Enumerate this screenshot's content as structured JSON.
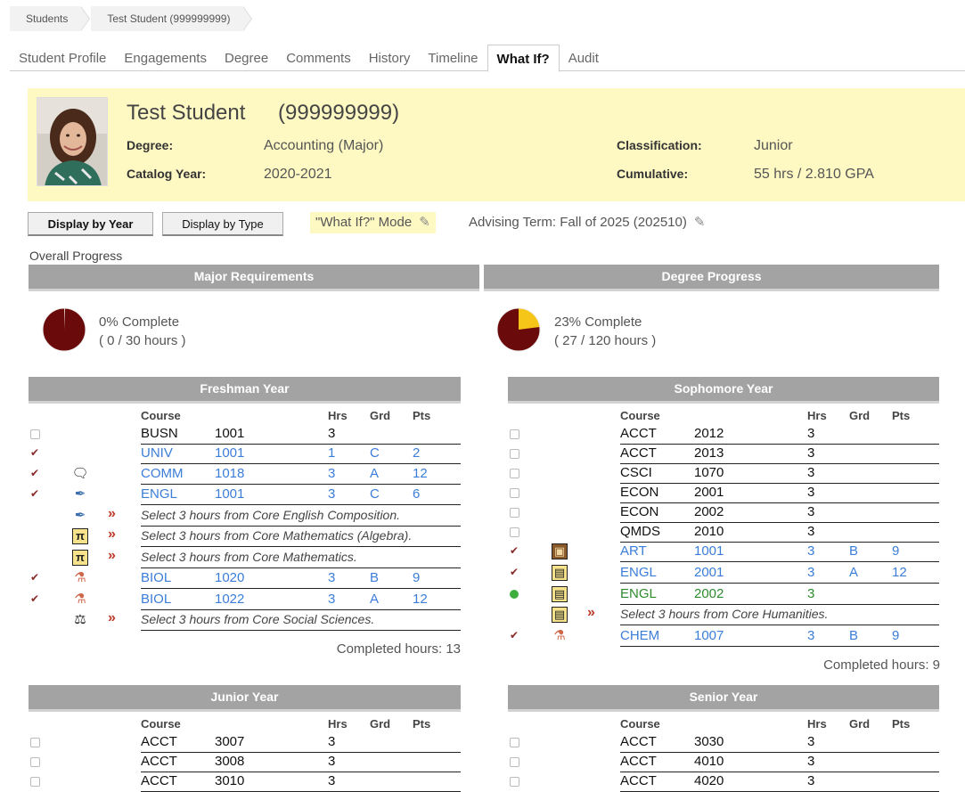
{
  "breadcrumb": [
    "Students",
    "Test Student (999999999)"
  ],
  "tabs": [
    "Student Profile",
    "Engagements",
    "Degree",
    "Comments",
    "History",
    "Timeline",
    "What If?",
    "Audit"
  ],
  "active_tab": "What If?",
  "profile": {
    "name": "Test Student",
    "id": "(999999999)",
    "degree_label": "Degree:",
    "degree": "Accounting (Major)",
    "catalog_label": "Catalog Year:",
    "catalog": "2020-2021",
    "class_label": "Classification:",
    "classification": "Junior",
    "cum_label": "Cumulative:",
    "cumulative": "55 hrs / 2.810 GPA"
  },
  "buttons": {
    "by_year": "Display by Year",
    "by_type": "Display by Type"
  },
  "mode": "\"What If?\" Mode",
  "advising_term": "Advising Term: Fall of 2025 (202510)",
  "overall": "Overall Progress",
  "major": {
    "title": "Major Requirements",
    "percent": 0,
    "pct_text": "0% Complete",
    "hours_text": "( 0 / 30 hours )"
  },
  "degree_progress": {
    "title": "Degree Progress",
    "percent": 23,
    "pct_text": "23% Complete",
    "hours_text": "( 27 / 120 hours )"
  },
  "col_headers": {
    "course": "Course",
    "hrs": "Hrs",
    "grd": "Grd",
    "pts": "Pts"
  },
  "colors": {
    "complete": "#6b0a0a",
    "remaining": "#f5c518",
    "link": "#3b7dd8",
    "inprogress": "#2e8b2e",
    "header": "#a3a3a3"
  },
  "freshman": {
    "title": "Freshman Year",
    "completed": "Completed hours: 13",
    "rows": [
      {
        "status": "box",
        "icon": "",
        "arrow": false,
        "subj": "BUSN",
        "num": "1001",
        "hrs": "3",
        "grd": "",
        "pts": "",
        "style": "black"
      },
      {
        "status": "check",
        "icon": "",
        "arrow": false,
        "subj": "UNIV",
        "num": "1001",
        "hrs": "1",
        "grd": "C",
        "pts": "2",
        "style": "blue"
      },
      {
        "status": "check",
        "icon": "speech-bubble-icon",
        "arrow": false,
        "subj": "COMM",
        "num": "1018",
        "hrs": "3",
        "grd": "A",
        "pts": "12",
        "style": "blue"
      },
      {
        "status": "check",
        "icon": "pen-icon",
        "arrow": false,
        "subj": "ENGL",
        "num": "1001",
        "hrs": "3",
        "grd": "C",
        "pts": "6",
        "style": "blue"
      },
      {
        "status": "",
        "icon": "pen-icon",
        "arrow": true,
        "select": "Select 3 hours from Core English Composition."
      },
      {
        "status": "",
        "icon": "pi-icon",
        "arrow": true,
        "select": "Select 3 hours from Core Mathematics (Algebra)."
      },
      {
        "status": "",
        "icon": "pi-icon",
        "arrow": true,
        "select": "Select 3 hours from Core Mathematics."
      },
      {
        "status": "check",
        "icon": "beaker-icon",
        "arrow": false,
        "subj": "BIOL",
        "num": "1020",
        "hrs": "3",
        "grd": "B",
        "pts": "9",
        "style": "blue"
      },
      {
        "status": "check",
        "icon": "beaker-icon",
        "arrow": false,
        "subj": "BIOL",
        "num": "1022",
        "hrs": "3",
        "grd": "A",
        "pts": "12",
        "style": "blue"
      },
      {
        "status": "",
        "icon": "scales-icon",
        "arrow": true,
        "select": "Select 3 hours from Core Social Sciences."
      }
    ]
  },
  "sophomore": {
    "title": "Sophomore Year",
    "completed": "Completed hours: 9",
    "rows": [
      {
        "status": "box",
        "icon": "",
        "arrow": false,
        "subj": "ACCT",
        "num": "2012",
        "hrs": "3",
        "grd": "",
        "pts": "",
        "style": "black"
      },
      {
        "status": "box",
        "icon": "",
        "arrow": false,
        "subj": "ACCT",
        "num": "2013",
        "hrs": "3",
        "grd": "",
        "pts": "",
        "style": "black"
      },
      {
        "status": "box",
        "icon": "",
        "arrow": false,
        "subj": "CSCI",
        "num": "1070",
        "hrs": "3",
        "grd": "",
        "pts": "",
        "style": "black"
      },
      {
        "status": "box",
        "icon": "",
        "arrow": false,
        "subj": "ECON",
        "num": "2001",
        "hrs": "3",
        "grd": "",
        "pts": "",
        "style": "black"
      },
      {
        "status": "box",
        "icon": "",
        "arrow": false,
        "subj": "ECON",
        "num": "2002",
        "hrs": "3",
        "grd": "",
        "pts": "",
        "style": "black"
      },
      {
        "status": "box",
        "icon": "",
        "arrow": false,
        "subj": "QMDS",
        "num": "2010",
        "hrs": "3",
        "grd": "",
        "pts": "",
        "style": "black"
      },
      {
        "status": "check",
        "icon": "art-icon",
        "arrow": false,
        "subj": "ART",
        "num": "1001",
        "hrs": "3",
        "grd": "B",
        "pts": "9",
        "style": "blue"
      },
      {
        "status": "check",
        "icon": "book-icon",
        "arrow": false,
        "subj": "ENGL",
        "num": "2001",
        "hrs": "3",
        "grd": "A",
        "pts": "12",
        "style": "blue"
      },
      {
        "status": "dot",
        "icon": "book-icon",
        "arrow": false,
        "subj": "ENGL",
        "num": "2002",
        "hrs": "3",
        "grd": "",
        "pts": "",
        "style": "green"
      },
      {
        "status": "",
        "icon": "book-icon",
        "arrow": true,
        "select": "Select 3 hours from Core Humanities."
      },
      {
        "status": "check",
        "icon": "beaker-icon",
        "arrow": false,
        "subj": "CHEM",
        "num": "1007",
        "hrs": "3",
        "grd": "B",
        "pts": "9",
        "style": "blue"
      }
    ]
  },
  "junior": {
    "title": "Junior Year",
    "rows": [
      {
        "status": "box",
        "icon": "",
        "arrow": false,
        "subj": "ACCT",
        "num": "3007",
        "hrs": "3",
        "grd": "",
        "pts": "",
        "style": "black"
      },
      {
        "status": "box",
        "icon": "",
        "arrow": false,
        "subj": "ACCT",
        "num": "3008",
        "hrs": "3",
        "grd": "",
        "pts": "",
        "style": "black"
      },
      {
        "status": "box",
        "icon": "",
        "arrow": false,
        "subj": "ACCT",
        "num": "3010",
        "hrs": "3",
        "grd": "",
        "pts": "",
        "style": "black"
      }
    ]
  },
  "senior": {
    "title": "Senior Year",
    "rows": [
      {
        "status": "box",
        "icon": "",
        "arrow": false,
        "subj": "ACCT",
        "num": "3030",
        "hrs": "3",
        "grd": "",
        "pts": "",
        "style": "black"
      },
      {
        "status": "box",
        "icon": "",
        "arrow": false,
        "subj": "ACCT",
        "num": "4010",
        "hrs": "3",
        "grd": "",
        "pts": "",
        "style": "black"
      },
      {
        "status": "box",
        "icon": "",
        "arrow": false,
        "subj": "ACCT",
        "num": "4020",
        "hrs": "3",
        "grd": "",
        "pts": "",
        "style": "black"
      }
    ]
  }
}
